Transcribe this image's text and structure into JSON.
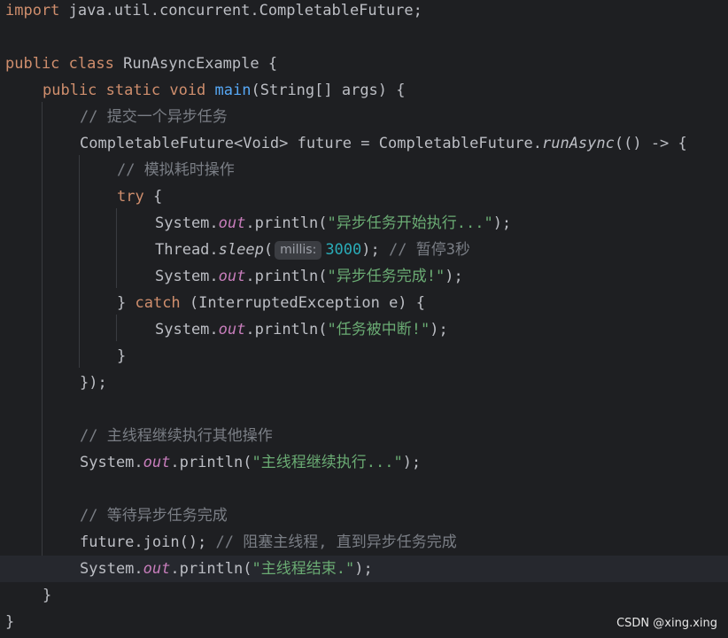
{
  "editor": {
    "lines": [
      [
        "import",
        " java.util.concurrent.CompletableFuture;"
      ],
      [],
      [
        "public",
        " ",
        "class",
        " RunAsyncExample {"
      ],
      [
        "public",
        " ",
        "static",
        " ",
        "void",
        " ",
        "main",
        "(String[] args) {"
      ],
      [
        "// 提交一个异步任务"
      ],
      [
        "CompletableFuture<Void> future = CompletableFuture.",
        "runAsync",
        "(() -> {"
      ],
      [
        "// 模拟耗时操作"
      ],
      [
        "try",
        " {"
      ],
      [
        "System.",
        "out",
        ".println(",
        "\"异步任务开始执行...\"",
        ");"
      ],
      [
        "Thread.",
        "sleep",
        "(",
        "millis:",
        "3000",
        "); ",
        "// 暂停3秒"
      ],
      [
        "System.",
        "out",
        ".println(",
        "\"异步任务完成!\"",
        ");"
      ],
      [
        "} ",
        "catch",
        " (InterruptedException e) {"
      ],
      [
        "System.",
        "out",
        ".println(",
        "\"任务被中断!\"",
        ");"
      ],
      [
        "}"
      ],
      [
        "});"
      ],
      [],
      [
        "// 主线程继续执行其他操作"
      ],
      [
        "System.",
        "out",
        ".println(",
        "\"主线程继续执行...\"",
        ");"
      ],
      [],
      [
        "// 等待异步任务完成"
      ],
      [
        "future.join(); ",
        "// 阻塞主线程, 直到异步任务完成"
      ],
      [
        "System.",
        "out",
        ".println(",
        "\"主线程结束.\"",
        ");"
      ],
      [
        "}"
      ],
      [
        "}"
      ]
    ]
  },
  "watermark": "CSDN @xing.xing",
  "colors": {
    "background": "#1e1f22",
    "current_line": "#26282e",
    "default_text": "#bcbec4",
    "keyword": "#cf8e6d",
    "method_declaration": "#56a8f5",
    "string": "#6aab73",
    "comment": "#7a7e85",
    "number": "#2aacb8",
    "static_field": "#c77dbb",
    "inlay_hint_bg": "#3b3d42"
  }
}
